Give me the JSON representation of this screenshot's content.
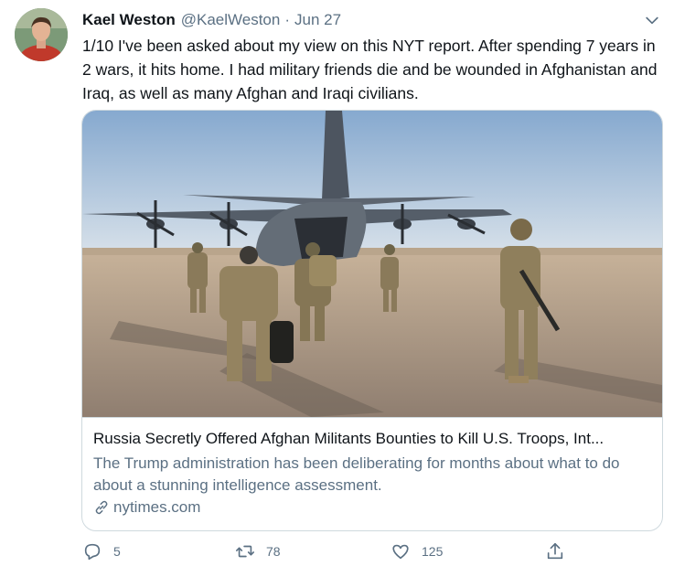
{
  "tweet": {
    "author_name": "Kael Weston",
    "handle": "@KaelWeston",
    "separator": "·",
    "date": "Jun 27",
    "text": "1/10 I've been asked about my view on this NYT report. After spending 7 years in 2 wars, it hits home. I had military friends die and be wounded in Afghanistan and Iraq, as well as many Afghan and Iraqi civilians."
  },
  "card": {
    "title": "Russia Secretly Offered Afghan Militants Bounties to Kill U.S. Troops, Int...",
    "description": "The Trump administration has been deliberating for months about what to do about a stunning intelligence assessment.",
    "domain": "nytimes.com"
  },
  "actions": {
    "reply_count": "5",
    "retweet_count": "78",
    "like_count": "125"
  },
  "colors": {
    "text": "#0f1419",
    "secondary": "#5b7083",
    "border": "#cfd9de"
  },
  "icons": [
    "more-chevron-icon",
    "link-icon",
    "reply-icon",
    "retweet-icon",
    "like-icon",
    "share-icon"
  ]
}
